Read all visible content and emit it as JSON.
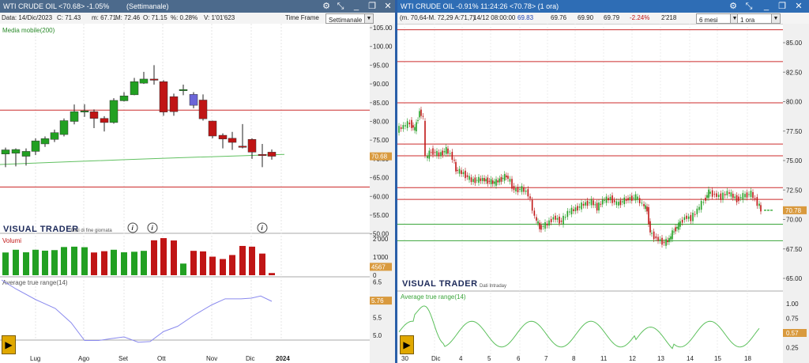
{
  "left": {
    "title": "WTI CRUDE OIL <70.68> -1.05%",
    "period": "(Settimanale)",
    "info": {
      "date": "Data: 14/Dic/2023",
      "close": "C: 71.43",
      "min": "m: 67.71",
      "max": "M: 72.46",
      "open": "O: 71.15",
      "pct": "%: 0.28%",
      "vol": "V: 1'01'623"
    },
    "timeframe_label": "Time Frame",
    "timeframe_value": "Settimanale",
    "indicator_ma": "Media mobile(200)",
    "brand": "VISUAL TRADER",
    "brand_sub": "Dati di fine giornata",
    "volume_label": "Volumi",
    "atr_label": "Average true range(14)",
    "price_badge": "70.68",
    "vol_badge": "4567",
    "atr_badge": "5.76",
    "x_labels": [
      "Lug",
      "Ago",
      "Set",
      "Ott",
      "Nov",
      "Dic",
      "2024"
    ],
    "y_labels": [
      "105.00",
      "100.00",
      "95.00",
      "90.00",
      "85.00",
      "80.00",
      "75.00",
      "70.00",
      "65.00",
      "60.00",
      "55.00",
      "50.00"
    ],
    "vol_labels": [
      "2'000",
      "1'000",
      "0"
    ],
    "atr_labels": [
      "6.5",
      "6.0",
      "5.5",
      "5.0"
    ],
    "info_icon": "i"
  },
  "right": {
    "title": "WTI CRUDE OIL -0.91% 11:24:26 <70.78> (1 ora)",
    "info": {
      "ma": "(m. 70,64-M. 72,29 A:71,7)",
      "datetime": "14/12 08:00:00",
      "v1": "69.83",
      "v2": "69.76",
      "v3": "69.90",
      "v4": "69.79",
      "pct": "-2.24%",
      "vol": "2'218"
    },
    "range_value": "6 mesi",
    "tf_value": "1 ora",
    "brand": "VISUAL TRADER",
    "brand_sub": "Dati Intraday",
    "atr_label": "Average true range(14)",
    "price_badge": "70.78",
    "atr_badge": "0.57",
    "x_labels": [
      "30",
      "Dic",
      "4",
      "5",
      "6",
      "7",
      "8",
      "11",
      "12",
      "13",
      "14",
      "15",
      "18"
    ],
    "y_labels": [
      "85.00",
      "82.50",
      "80.00",
      "77.50",
      "75.00",
      "72.50",
      "70.00",
      "67.50",
      "65.00"
    ],
    "atr_labels": [
      "1.00",
      "0.75",
      "0.50",
      "0.25"
    ]
  },
  "colors": {
    "up": "#22a022",
    "down": "#c01515",
    "line_red": "#cc2b2b",
    "line_green": "#3aa53a",
    "ma_green": "#60c060",
    "atr_blue": "#8a8aee"
  }
}
